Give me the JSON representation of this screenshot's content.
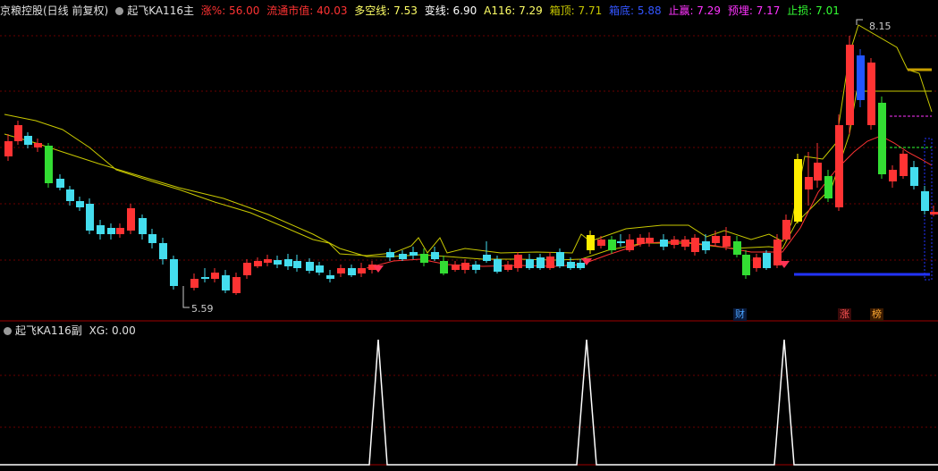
{
  "main_header": {
    "stock": "京粮控股(日线 前复权)",
    "formula": "起飞KA116主",
    "items": [
      {
        "label": "涨%: 56.00",
        "color": "#ff3333"
      },
      {
        "label": "流通市值: 40.03",
        "color": "#ff3333"
      },
      {
        "label": "多空线: 7.53",
        "color": "#ffff66"
      },
      {
        "label": "变线: 6.90",
        "color": "#ffffff"
      },
      {
        "label": "A116: 7.29",
        "color": "#ffff66"
      },
      {
        "label": "箱顶: 7.71",
        "color": "#c8c800"
      },
      {
        "label": "箱底: 5.88",
        "color": "#3333ff"
      },
      {
        "label": "止赢: 7.29",
        "color": "#ff33ff"
      },
      {
        "label": "预埋: 7.17",
        "color": "#ff33ff"
      },
      {
        "label": "止损: 7.01",
        "color": "#33ff33"
      }
    ]
  },
  "main_chart": {
    "high_label": "8.15",
    "low_label": "5.59",
    "tags": [
      {
        "text": "财",
        "color": "#4aa3ff"
      },
      {
        "text": "涨",
        "color": "#ff5555"
      },
      {
        "text": "榜",
        "color": "#ffaa33"
      }
    ]
  },
  "sub_header": {
    "formula": "起飞KA116副",
    "value": "XG: 0.00"
  },
  "colors": {
    "up": "#ff3333",
    "down": "#44ddee",
    "line": "#c8c800",
    "grid": "#7a0000"
  }
}
